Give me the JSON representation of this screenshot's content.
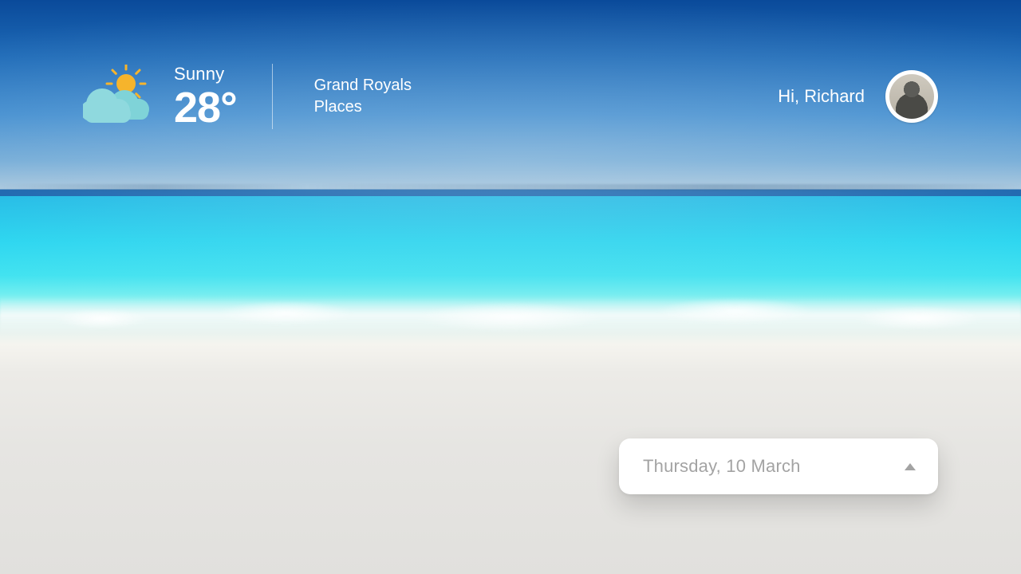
{
  "weather": {
    "condition": "Sunny",
    "temperature": "28°"
  },
  "location": {
    "line1": "Grand Royals",
    "line2": "Places"
  },
  "user": {
    "greeting": "Hi, Richard"
  },
  "datePicker": {
    "value": "Thursday, 10 March"
  }
}
